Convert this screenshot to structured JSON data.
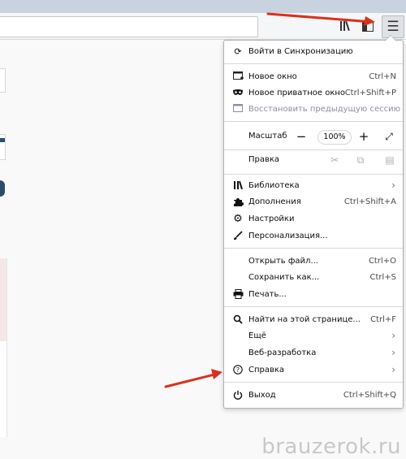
{
  "toolbar": {
    "library_icon": "library-icon",
    "sidebar_icon": "sidebar-icon",
    "menu_icon": "hamburger-menu-icon"
  },
  "menu": {
    "sync": {
      "label": "Войти в Синхронизацию",
      "icon": "sync-icon"
    },
    "new_window": {
      "label": "Новое окно",
      "shortcut": "Ctrl+N",
      "icon": "new-window-icon"
    },
    "private_window": {
      "label": "Новое приватное окно",
      "shortcut": "Ctrl+Shift+P",
      "icon": "private-mask-icon"
    },
    "restore_session": {
      "label": "Восстановить предыдущую сессию",
      "icon": "restore-session-icon"
    },
    "zoom": {
      "label": "Масштаб",
      "value": "100%",
      "minus": "−",
      "plus": "+"
    },
    "edit": {
      "label": "Правка"
    },
    "library": {
      "label": "Библиотека",
      "icon": "library-icon"
    },
    "addons": {
      "label": "Дополнения",
      "shortcut": "Ctrl+Shift+A",
      "icon": "puzzle-icon"
    },
    "settings": {
      "label": "Настройки",
      "icon": "gear-icon"
    },
    "customize": {
      "label": "Персонализация...",
      "icon": "brush-icon"
    },
    "open_file": {
      "label": "Открыть файл...",
      "shortcut": "Ctrl+O"
    },
    "save_as": {
      "label": "Сохранить как...",
      "shortcut": "Ctrl+S"
    },
    "print": {
      "label": "Печать...",
      "icon": "printer-icon"
    },
    "find": {
      "label": "Найти на этой странице...",
      "shortcut": "Ctrl+F",
      "icon": "search-icon"
    },
    "more": {
      "label": "Ещё"
    },
    "web_dev": {
      "label": "Веб-разработка"
    },
    "help": {
      "label": "Справка",
      "icon": "help-icon"
    },
    "exit": {
      "label": "Выход",
      "shortcut": "Ctrl+Shift+Q",
      "icon": "power-icon"
    }
  },
  "colors": {
    "annotation_arrow": "#d9301c"
  },
  "watermark": "brauzerok.ru"
}
